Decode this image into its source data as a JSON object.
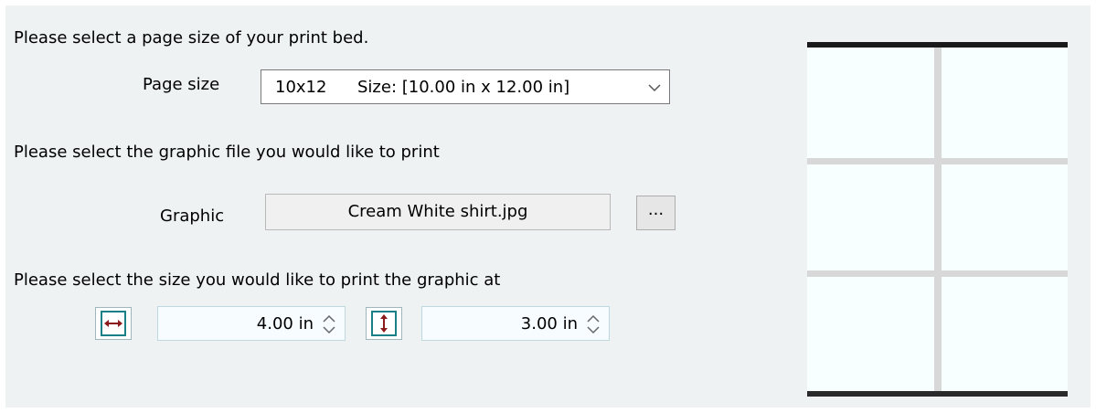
{
  "page_size_section": {
    "prompt": "Please select a page size of your print bed.",
    "label": "Page size",
    "selected_code": "10x12",
    "selected_desc": "Size: [10.00 in x 12.00 in]"
  },
  "graphic_section": {
    "prompt": "Please select the graphic file you would like to print",
    "label": "Graphic",
    "filename": "Cream White shirt.jpg",
    "browse_label": "..."
  },
  "size_section": {
    "prompt": "Please select the size you would like to print the graphic at",
    "width_value": "4.00 in",
    "height_value": "3.00 in"
  },
  "icons": {
    "width": "horizontal-arrows-icon",
    "height": "vertical-arrows-icon",
    "dropdown": "chevron-down-icon",
    "spinner": "spinner-arrows-icon"
  },
  "colors": {
    "panel_bg": "#eef2f2",
    "icon_arrow": "#8b1a1a",
    "icon_frame": "#1a7f86",
    "preview_bg": "#f7ffff",
    "preview_grid": "#d8d8d8"
  },
  "preview": {
    "columns": 2,
    "rows": 3
  }
}
